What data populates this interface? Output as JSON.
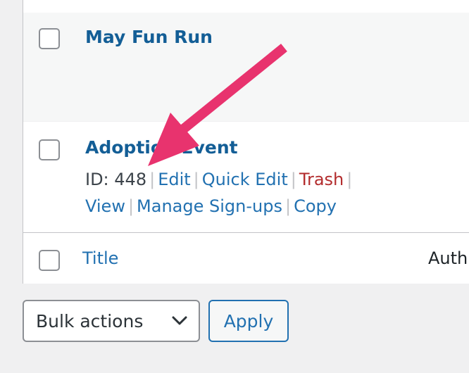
{
  "posts": [
    {
      "title": "May Fun Run"
    },
    {
      "title": "Adoption Event",
      "id_label": "ID: 448",
      "actions": {
        "edit": "Edit",
        "quick_edit": "Quick Edit",
        "trash": "Trash",
        "view": "View",
        "manage_signups": "Manage Sign-ups",
        "copy": "Copy"
      }
    }
  ],
  "footer": {
    "title_column": "Title",
    "author_column": "Auth"
  },
  "bulk": {
    "select_value": "Bulk actions",
    "apply_label": "Apply"
  },
  "colors": {
    "link": "#2271b1",
    "title_link": "#135e96",
    "trash": "#b32d2e",
    "arrow": "#e8336e"
  },
  "icons": {
    "select_chevron": "chevron-down-icon",
    "annotation": "arrow-annotation"
  }
}
